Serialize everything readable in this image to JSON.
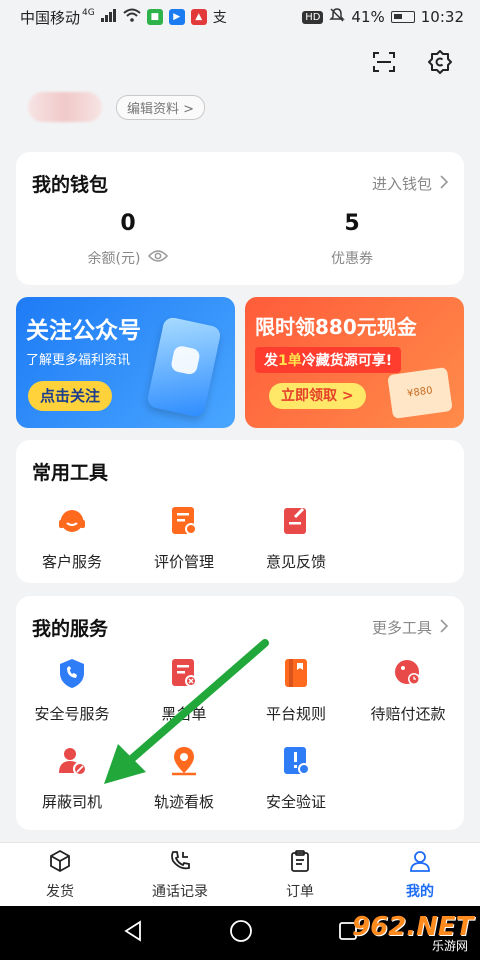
{
  "status_bar": {
    "carrier": "中国移动",
    "network": "4G",
    "battery": "41%",
    "time": "10:32",
    "hd": "HD"
  },
  "profile": {
    "edit_label": "编辑资料 >"
  },
  "wallet": {
    "title": "我的钱包",
    "link": "进入钱包",
    "balance_value": "0",
    "balance_label": "余额(元)",
    "coupon_value": "5",
    "coupon_label": "优惠券"
  },
  "banners": {
    "left": {
      "title": "关注公众号",
      "subtitle": "了解更多福利资讯",
      "button": "点击关注"
    },
    "right": {
      "title": "限时领880元现金",
      "subtitle_prefix": "发",
      "subtitle_highlight": "1单",
      "subtitle_suffix": "冷藏货源可享!",
      "button": "立即领取 >",
      "coupon_text": "¥880"
    }
  },
  "tools": {
    "title": "常用工具",
    "items": [
      {
        "label": "客户服务",
        "icon": "customer-service-icon"
      },
      {
        "label": "评价管理",
        "icon": "review-manage-icon"
      },
      {
        "label": "意见反馈",
        "icon": "feedback-icon"
      }
    ]
  },
  "services": {
    "title": "我的服务",
    "link": "更多工具",
    "items": [
      {
        "label": "安全号服务",
        "icon": "safe-number-icon"
      },
      {
        "label": "黑名单",
        "icon": "blacklist-icon"
      },
      {
        "label": "平台规则",
        "icon": "platform-rules-icon"
      },
      {
        "label": "待赔付还款",
        "icon": "pending-repay-icon"
      },
      {
        "label": "屏蔽司机",
        "icon": "block-driver-icon"
      },
      {
        "label": "轨迹看板",
        "icon": "track-board-icon"
      },
      {
        "label": "安全验证",
        "icon": "security-verify-icon"
      }
    ]
  },
  "tab_bar": {
    "items": [
      {
        "label": "发货",
        "icon": "box-icon"
      },
      {
        "label": "通话记录",
        "icon": "phone-record-icon"
      },
      {
        "label": "订单",
        "icon": "order-icon"
      },
      {
        "label": "我的",
        "icon": "person-icon"
      }
    ]
  },
  "watermark": {
    "text": "962.NET",
    "sub": "乐游网"
  },
  "colors": {
    "accent": "#1e6cf5",
    "orange": "#ff6a1f",
    "red": "#e84a4a",
    "arrow": "#22a83a"
  }
}
